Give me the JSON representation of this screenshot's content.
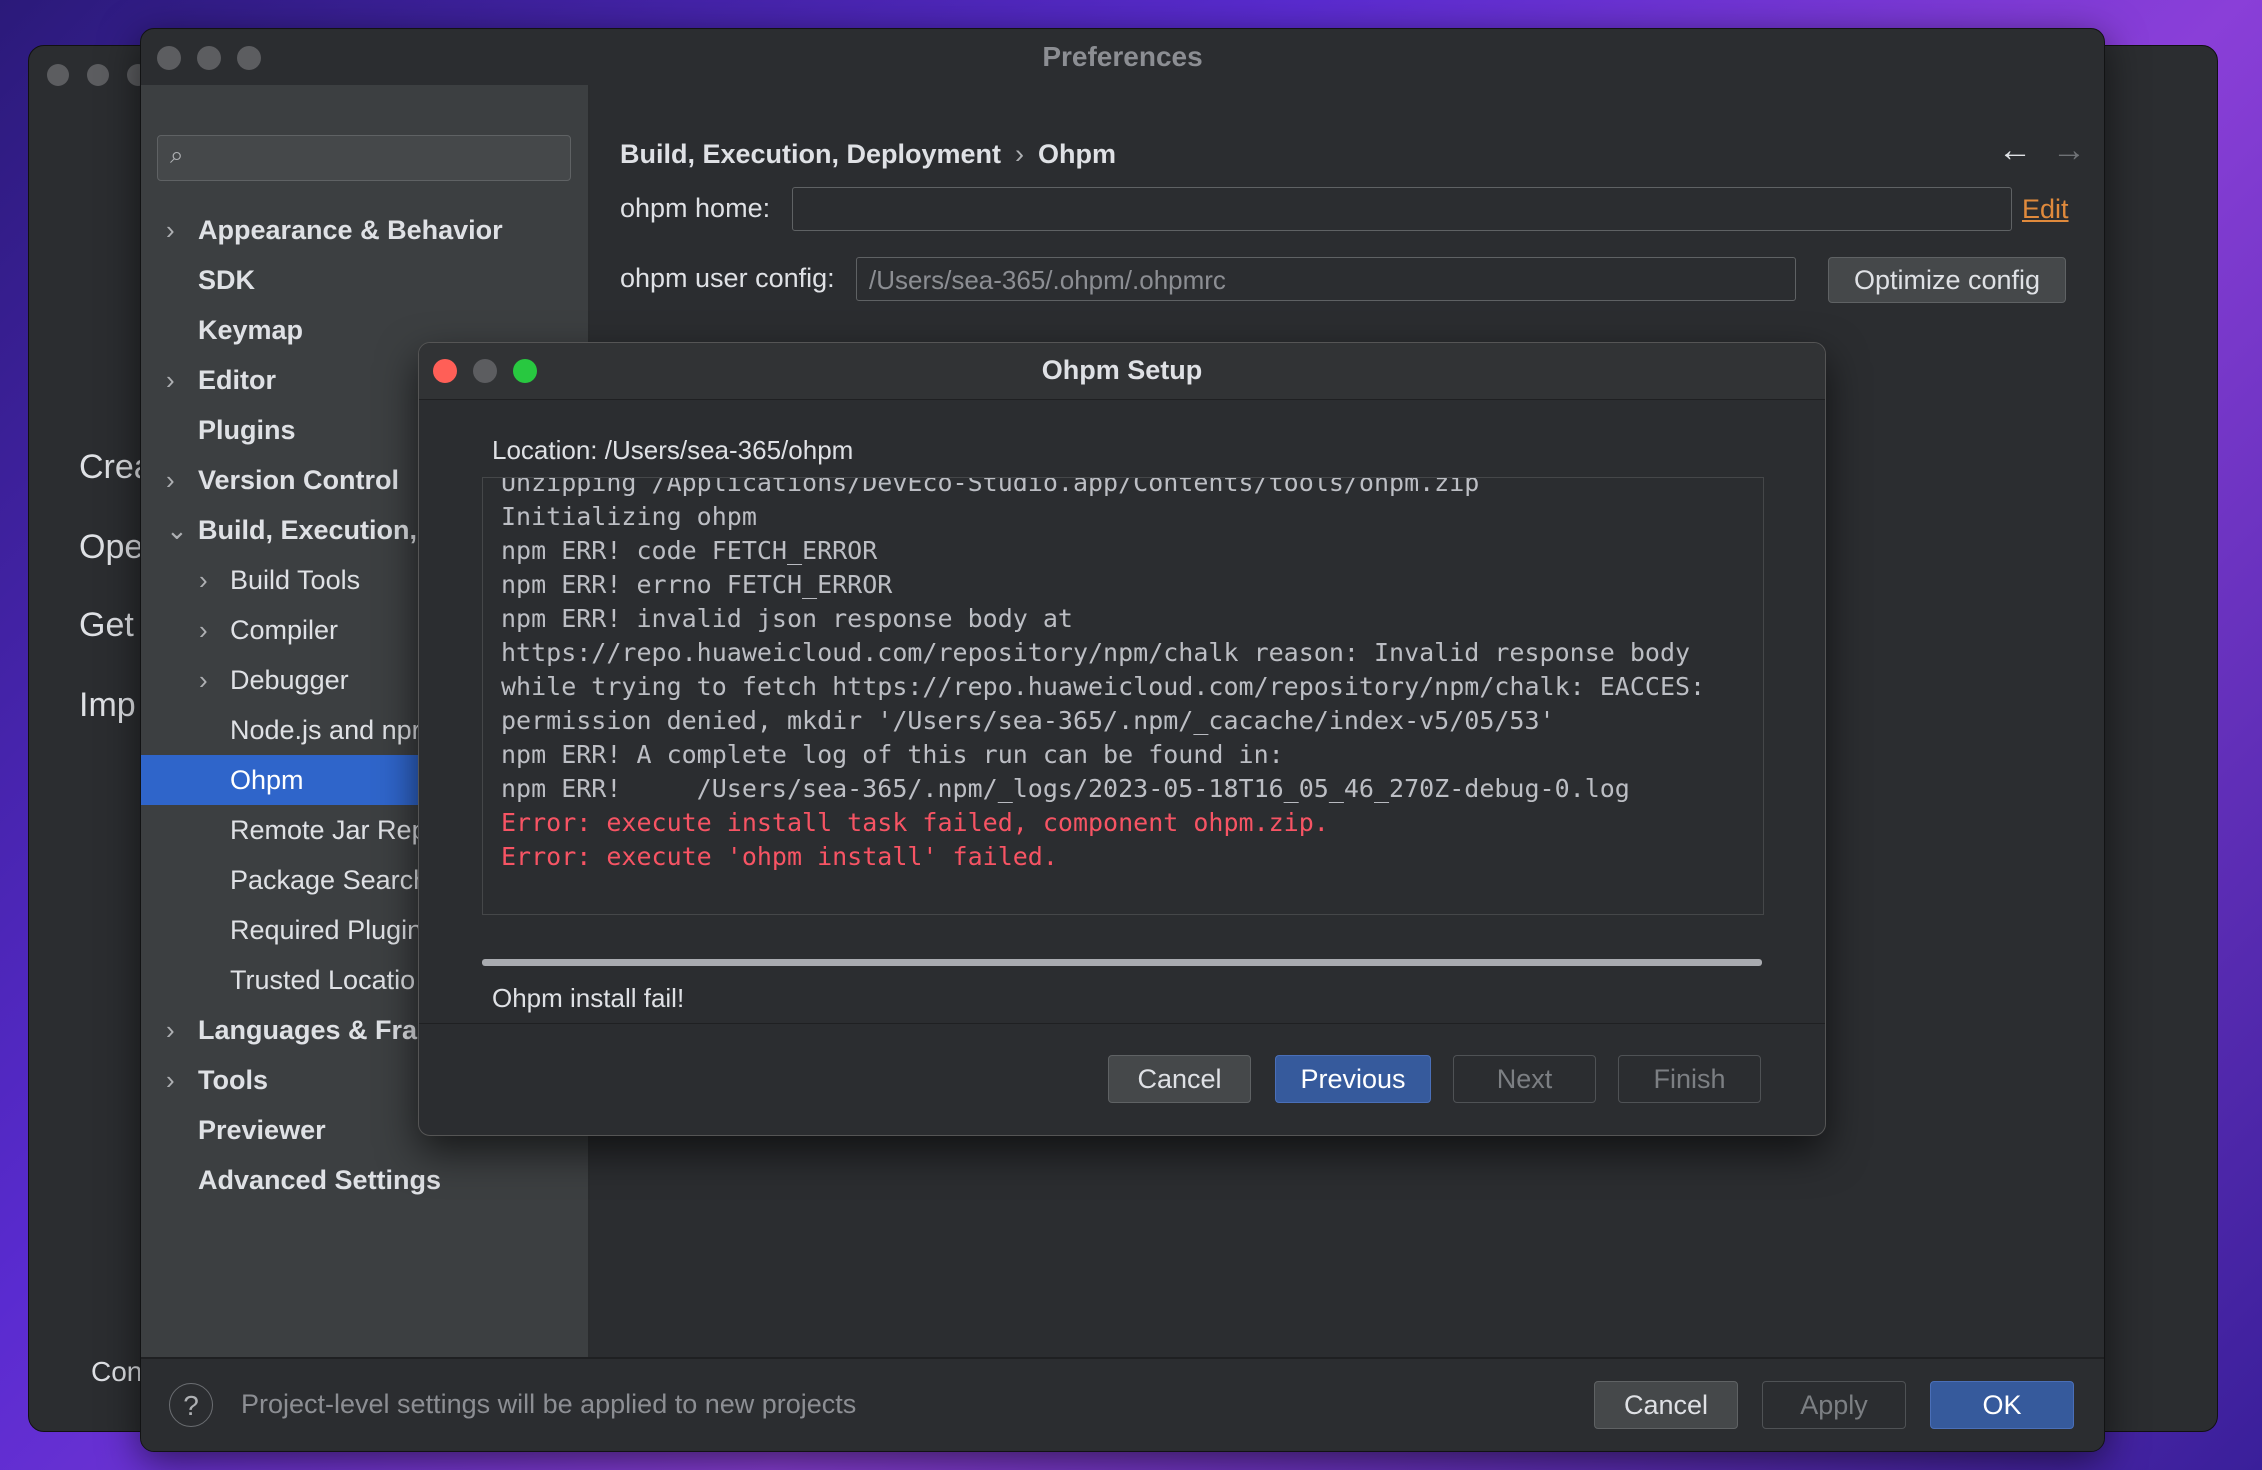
{
  "background_window": {
    "left_items": [
      "Crea",
      "Ope",
      "Get",
      "Imp",
      "Con"
    ]
  },
  "preferences": {
    "title": "Preferences",
    "search": {
      "placeholder": ""
    },
    "nav": [
      {
        "label": "Appearance & Behavior",
        "level": 0,
        "chevron": "right"
      },
      {
        "label": "SDK",
        "level": 0,
        "chevron": "none"
      },
      {
        "label": "Keymap",
        "level": 0,
        "chevron": "none"
      },
      {
        "label": "Editor",
        "level": 0,
        "chevron": "right"
      },
      {
        "label": "Plugins",
        "level": 0,
        "chevron": "none"
      },
      {
        "label": "Version Control",
        "level": 0,
        "chevron": "right"
      },
      {
        "label": "Build, Execution, I",
        "level": 0,
        "chevron": "down"
      },
      {
        "label": "Build Tools",
        "level": 1,
        "chevron": "right"
      },
      {
        "label": "Compiler",
        "level": 1,
        "chevron": "right"
      },
      {
        "label": "Debugger",
        "level": 1,
        "chevron": "right"
      },
      {
        "label": "Node.js and npr",
        "level": 1,
        "chevron": "none"
      },
      {
        "label": "Ohpm",
        "level": 1,
        "chevron": "none",
        "selected": true
      },
      {
        "label": "Remote Jar Rep",
        "level": 1,
        "chevron": "none"
      },
      {
        "label": "Package Search",
        "level": 1,
        "chevron": "none"
      },
      {
        "label": "Required Plugins",
        "level": 1,
        "chevron": "none"
      },
      {
        "label": "Trusted Locatio",
        "level": 1,
        "chevron": "none"
      },
      {
        "label": "Languages & Fran",
        "level": 0,
        "chevron": "right"
      },
      {
        "label": "Tools",
        "level": 0,
        "chevron": "right"
      },
      {
        "label": "Previewer",
        "level": 0,
        "chevron": "none"
      },
      {
        "label": "Advanced Settings",
        "level": 0,
        "chevron": "none"
      }
    ],
    "breadcrumb": {
      "parent": "Build, Execution, Deployment",
      "separator": "›",
      "current": "Ohpm"
    },
    "ohpm_home": {
      "label": "ohpm home:",
      "value": "",
      "edit_label": "Edit"
    },
    "ohpm_user_config": {
      "label": "ohpm user config:",
      "value": "/Users/sea-365/.ohpm/.ohpmrc",
      "button": "Optimize config"
    },
    "footer": {
      "help": "?",
      "note": "Project-level settings will be applied to new projects",
      "cancel": "Cancel",
      "apply": "Apply",
      "ok": "OK"
    }
  },
  "dialog": {
    "title": "Ohpm Setup",
    "location": "Location: /Users/sea-365/ohpm",
    "log": [
      {
        "text": "Unzipping /Applications/DevEco-Studio.app/Contents/tools/ohpm.zip",
        "error": false
      },
      {
        "text": "Initializing ohpm",
        "error": false
      },
      {
        "text": "npm ERR! code FETCH_ERROR",
        "error": false
      },
      {
        "text": "npm ERR! errno FETCH_ERROR",
        "error": false
      },
      {
        "text": "npm ERR! invalid json response body at",
        "error": false
      },
      {
        "text": "https://repo.huaweicloud.com/repository/npm/chalk reason: Invalid response body",
        "error": false
      },
      {
        "text": "while trying to fetch https://repo.huaweicloud.com/repository/npm/chalk: EACCES:",
        "error": false
      },
      {
        "text": "permission denied, mkdir '/Users/sea-365/.npm/_cacache/index-v5/05/53'",
        "error": false
      },
      {
        "text": "npm ERR! A complete log of this run can be found in:",
        "error": false
      },
      {
        "text": "npm ERR!     /Users/sea-365/.npm/_logs/2023-05-18T16_05_46_270Z-debug-0.log",
        "error": false
      },
      {
        "text": "Error: execute install task failed, component ohpm.zip.",
        "error": true
      },
      {
        "text": "Error: execute 'ohpm install' failed.",
        "error": true
      }
    ],
    "progress": 1.0,
    "status": "Ohpm install fail!",
    "buttons": {
      "cancel": "Cancel",
      "previous": "Previous",
      "next": "Next",
      "finish": "Finish"
    }
  }
}
